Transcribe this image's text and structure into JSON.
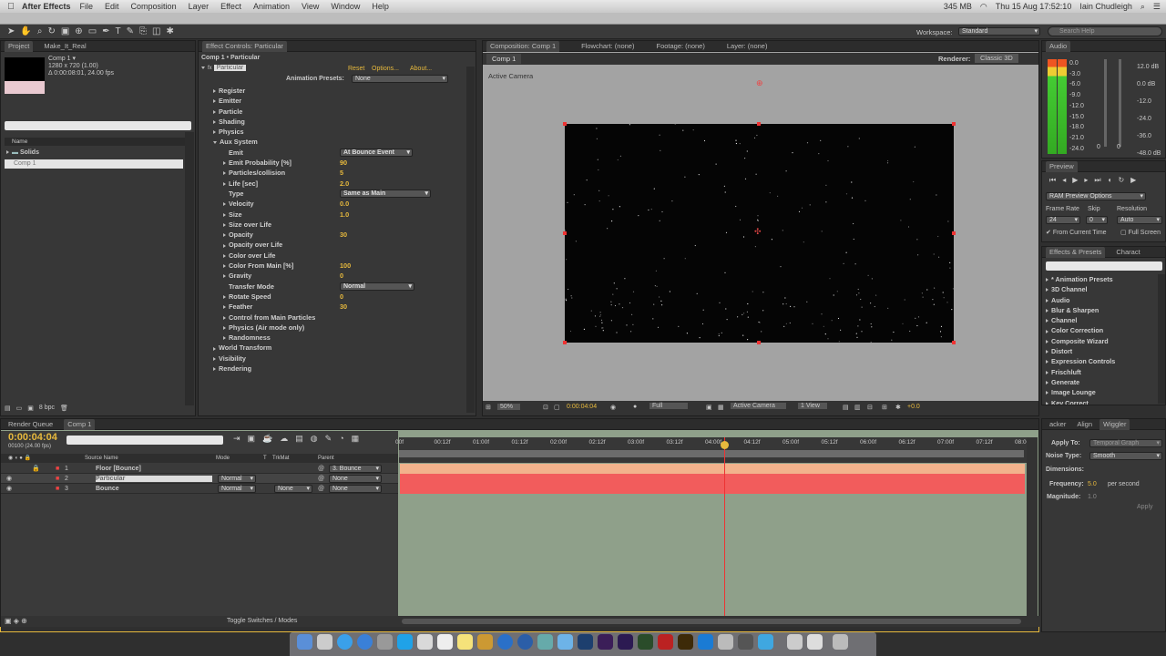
{
  "menubar": {
    "app": "After Effects",
    "items": [
      "File",
      "Edit",
      "Composition",
      "Layer",
      "Effect",
      "Animation",
      "View",
      "Window",
      "Help"
    ],
    "battery": "345 MB",
    "clock": "Thu 15 Aug  17:52:10",
    "user": "Iain Chudleigh"
  },
  "toolbar": {
    "workspace_label": "Workspace:",
    "workspace_value": "Standard",
    "search_placeholder": "Search Help"
  },
  "project": {
    "tab_project": "Project",
    "tab_file": "Make_It_Real",
    "comp_name": "Comp 1 ▾",
    "comp_size": "1280 x 720 (1.00)",
    "comp_duration": "Δ 0:00:08:01, 24.00 fps",
    "col_name": "Name",
    "folder": "Solids",
    "item": "Comp 1",
    "bpc": "8 bpc"
  },
  "effect_controls": {
    "tab": "Effect Controls: Particular",
    "layer_path": "Comp 1 • Particular",
    "effect_name": "Particular",
    "reset": "Reset",
    "options": "Options...",
    "about": "About...",
    "presets_label": "Animation Presets:",
    "presets_value": "None",
    "rows": [
      {
        "label": "Register",
        "level": 1,
        "open": false
      },
      {
        "label": "Emitter",
        "level": 1,
        "open": false
      },
      {
        "label": "Particle",
        "level": 1,
        "open": false
      },
      {
        "label": "Shading",
        "level": 1,
        "open": false
      },
      {
        "label": "Physics",
        "level": 1,
        "open": false
      },
      {
        "label": "Aux System",
        "level": 1,
        "open": true
      },
      {
        "label": "Emit",
        "level": 2,
        "dd": "At Bounce Event"
      },
      {
        "label": "Emit Probability [%]",
        "level": 2,
        "open": false,
        "value": "90"
      },
      {
        "label": "Particles/collision",
        "level": 2,
        "open": false,
        "value": "5"
      },
      {
        "label": "Life [sec]",
        "level": 2,
        "open": false,
        "value": "2.0"
      },
      {
        "label": "Type",
        "level": 2,
        "dd": "Same as Main"
      },
      {
        "label": "Velocity",
        "level": 2,
        "open": false,
        "value": "0.0"
      },
      {
        "label": "Size",
        "level": 2,
        "open": false,
        "value": "1.0"
      },
      {
        "label": "Size over Life",
        "level": 2,
        "open": false
      },
      {
        "label": "Opacity",
        "level": 2,
        "open": false,
        "value": "30"
      },
      {
        "label": "Opacity over Life",
        "level": 2,
        "open": false
      },
      {
        "label": "Color over Life",
        "level": 2,
        "open": false
      },
      {
        "label": "Color From Main [%]",
        "level": 2,
        "open": false,
        "value": "100"
      },
      {
        "label": "Gravity",
        "level": 2,
        "open": false,
        "value": "0"
      },
      {
        "label": "Transfer Mode",
        "level": 2,
        "dd": "Normal"
      },
      {
        "label": "Rotate Speed",
        "level": 2,
        "open": false,
        "value": "0"
      },
      {
        "label": "Feather",
        "level": 2,
        "open": false,
        "value": "30"
      },
      {
        "label": "Control from Main Particles",
        "level": 2,
        "open": false
      },
      {
        "label": "Physics (Air mode only)",
        "level": 2,
        "open": false
      },
      {
        "label": "Randomness",
        "level": 2,
        "open": false
      },
      {
        "label": "World Transform",
        "level": 1,
        "open": false
      },
      {
        "label": "Visibility",
        "level": 1,
        "open": false
      },
      {
        "label": "Rendering",
        "level": 1,
        "open": false
      }
    ]
  },
  "composition": {
    "tab": "Composition: Comp 1",
    "flowchart": "Flowchart: (none)",
    "footage": "Footage: (none)",
    "layer": "Layer: (none)",
    "subtab": "Comp 1",
    "renderer_label": "Renderer:",
    "renderer_value": "Classic 3D",
    "active_camera": "Active Camera",
    "zoom": "50%",
    "timecode": "0:00:04:04",
    "resolution": "Full",
    "camera_dd": "Active Camera",
    "view_dd": "1 View",
    "exposure": "+0.0"
  },
  "audio": {
    "tab": "Audio",
    "left_scale": [
      "0.0",
      "-3.0",
      "-6.0",
      "-9.0",
      "-12.0",
      "-15.0",
      "-18.0",
      "-21.0",
      "-24.0"
    ],
    "right_scale": [
      "12.0 dB",
      "0.0 dB",
      "-12.0",
      "-24.0",
      "-36.0",
      "-48.0 dB"
    ],
    "bottom_left": "0",
    "bottom_right": "0"
  },
  "preview": {
    "tab": "Preview",
    "ram_options": "RAM Preview Options",
    "frame_rate_label": "Frame Rate",
    "skip_label": "Skip",
    "resolution_label": "Resolution",
    "frame_rate": "24",
    "skip": "0",
    "resolution": "Auto",
    "from_current": "From Current Time",
    "full_screen": "Full Screen"
  },
  "effects_presets": {
    "tab": "Effects & Presets",
    "tab2": "Charact",
    "items": [
      "* Animation Presets",
      "3D Channel",
      "Audio",
      "Blur & Sharpen",
      "Channel",
      "Color Correction",
      "Composite Wizard",
      "Distort",
      "Expression Controls",
      "Frischluft",
      "Generate",
      "Image Lounge",
      "Key Correct"
    ]
  },
  "timeline": {
    "tab_render": "Render Queue",
    "tab_comp": "Comp 1",
    "timecode": "0:00:04:04",
    "frames": "00100 (24.00 fps)",
    "col_source": "Source Name",
    "col_mode": "Mode",
    "col_t": "T",
    "col_trkmat": "TrkMat",
    "col_parent": "Parent",
    "ruler": [
      "00f",
      "00:12f",
      "01:00f",
      "01:12f",
      "02:00f",
      "02:12f",
      "03:00f",
      "03:12f",
      "04:00f",
      "04:12f",
      "05:00f",
      "05:12f",
      "06:00f",
      "06:12f",
      "07:00f",
      "07:12f",
      "08:00"
    ],
    "layers": [
      {
        "num": "1",
        "name": "Floor [Bounce]",
        "mode": "",
        "trkmat": "",
        "parent": "3. Bounce"
      },
      {
        "num": "2",
        "name": "Particular",
        "mode": "Normal",
        "trkmat": "",
        "parent": "None"
      },
      {
        "num": "3",
        "name": "Bounce",
        "mode": "Normal",
        "trkmat": "None",
        "parent": "None"
      }
    ],
    "toggle": "Toggle Switches / Modes",
    "playhead_fraction": 0.5
  },
  "wiggler": {
    "tab1": "acker",
    "tab2": "Align",
    "tab3": "Wiggler",
    "apply_to_label": "Apply To:",
    "apply_to": "Temporal Graph",
    "noise_label": "Noise Type:",
    "noise": "Smooth",
    "dimensions_label": "Dimensions:",
    "frequency_label": "Frequency:",
    "frequency": "5.0",
    "frequency_unit": "per second",
    "magnitude_label": "Magnitude:",
    "magnitude": "1.0",
    "apply": "Apply"
  }
}
